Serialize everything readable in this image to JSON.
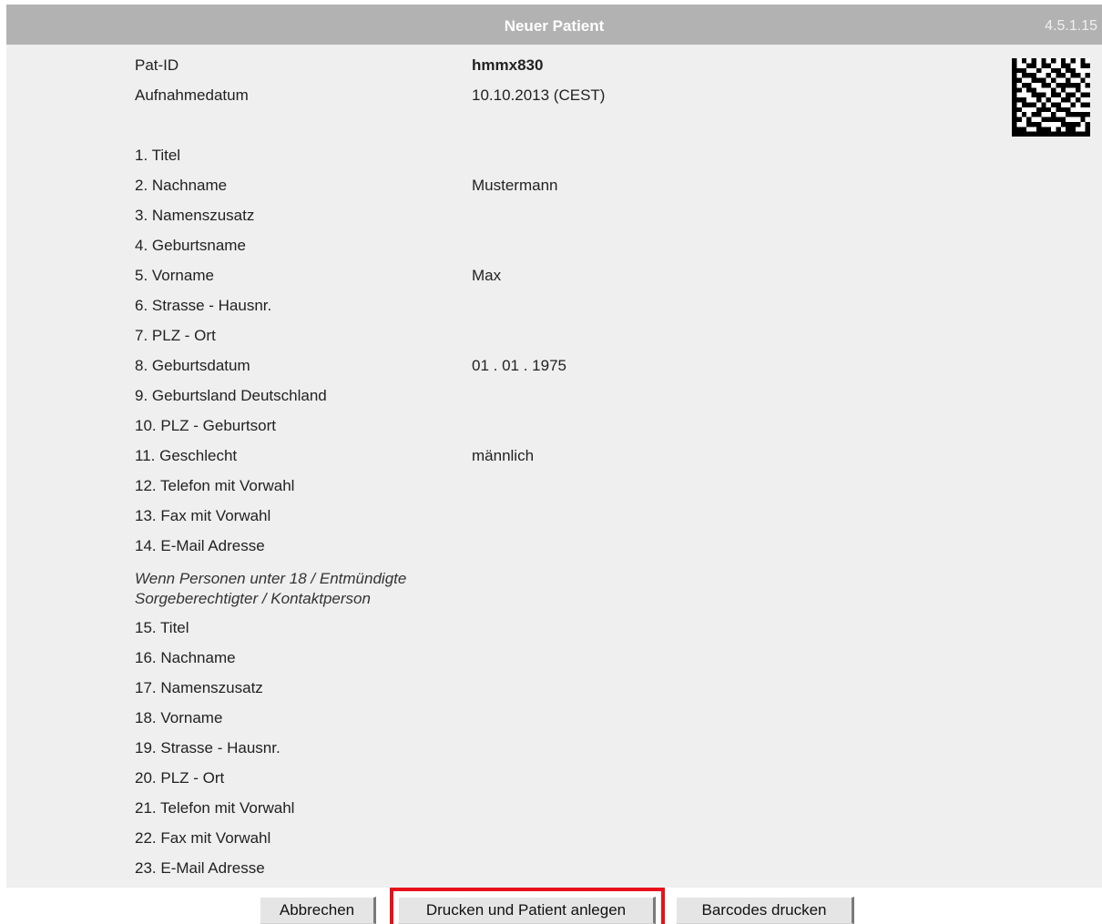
{
  "header": {
    "title": "Neuer Patient",
    "version": "4.5.1.15"
  },
  "info": {
    "pat_id_label": "Pat-ID",
    "pat_id_value": "hmmx830",
    "admission_label": "Aufnahmedatum",
    "admission_value": "10.10.2013 (CEST)"
  },
  "fields": [
    {
      "label": "1. Titel",
      "value": ""
    },
    {
      "label": "2. Nachname",
      "value": "Mustermann"
    },
    {
      "label": "3. Namenszusatz",
      "value": ""
    },
    {
      "label": "4. Geburtsname",
      "value": ""
    },
    {
      "label": "5. Vorname",
      "value": "Max"
    },
    {
      "label": "6. Strasse - Hausnr.",
      "value": ""
    },
    {
      "label": "7. PLZ - Ort",
      "value": ""
    },
    {
      "label": "8. Geburtsdatum",
      "value": "01 . 01 . 1975"
    },
    {
      "label": "9. Geburtsland Deutschland",
      "value": ""
    },
    {
      "label": "10. PLZ - Geburtsort",
      "value": ""
    },
    {
      "label": "11. Geschlecht",
      "value": "männlich"
    },
    {
      "label": "12. Telefon mit Vorwahl",
      "value": ""
    },
    {
      "label": "13. Fax mit Vorwahl",
      "value": ""
    },
    {
      "label": "14. E-Mail Adresse",
      "value": ""
    }
  ],
  "guardian_note": {
    "line1": "Wenn Personen unter 18 / Entmündigte",
    "line2": "Sorgeberechtigter / Kontaktperson"
  },
  "guardian_fields": [
    {
      "label": "15. Titel"
    },
    {
      "label": "16. Nachname"
    },
    {
      "label": "17. Namenszusatz"
    },
    {
      "label": "18. Vorname"
    },
    {
      "label": "19. Strasse - Hausnr."
    },
    {
      "label": "20. PLZ - Ort"
    },
    {
      "label": "21. Telefon mit Vorwahl"
    },
    {
      "label": "22. Fax mit Vorwahl"
    },
    {
      "label": "23. E-Mail Adresse"
    }
  ],
  "buttons": {
    "cancel": "Abbrechen",
    "print_create": "Drucken und Patient anlegen",
    "barcodes": "Barcodes drucken"
  },
  "colors": {
    "header_bg": "#b2b2b2",
    "panel_bg": "#efefef",
    "highlight": "#e8111a"
  },
  "icons": {
    "barcode": "datamatrix-barcode-icon"
  }
}
